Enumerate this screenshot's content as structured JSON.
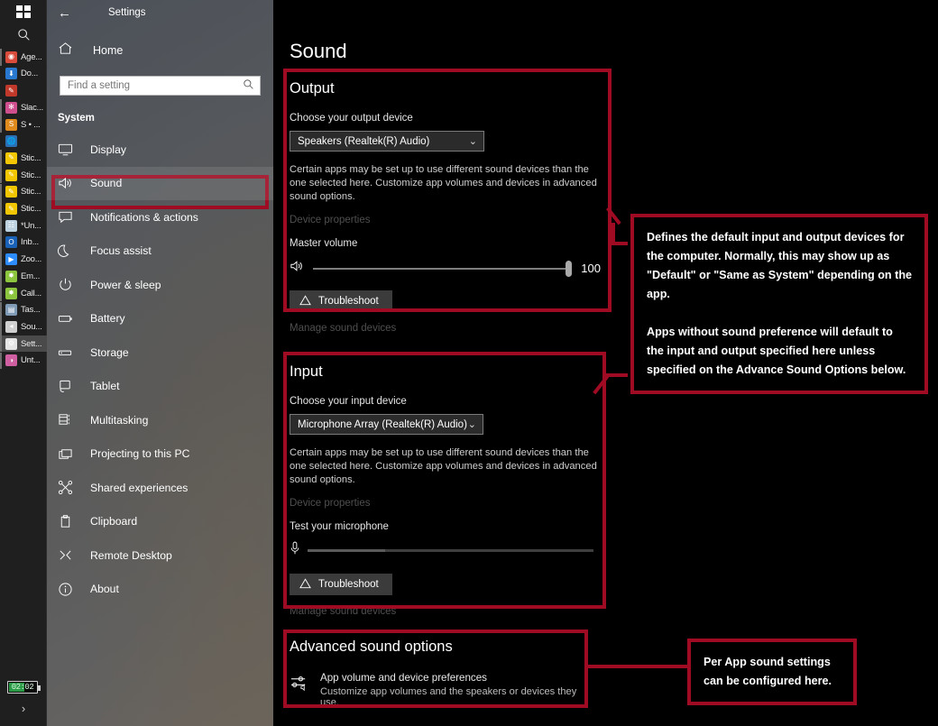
{
  "taskbar": {
    "start_icon": "windows-logo-icon",
    "search_icon": "search-icon",
    "battery": {
      "time": "02:02"
    },
    "overflow_chevron": "›",
    "items": [
      {
        "label": "Age...",
        "icon": "chrome-icon",
        "running": true,
        "active": false,
        "glyph": "◉",
        "color": "#d94b3a"
      },
      {
        "label": "Do...",
        "icon": "download-icon",
        "running": false,
        "active": false,
        "glyph": "⬇",
        "color": "#2878d0"
      },
      {
        "label": "",
        "icon": "paint-icon",
        "running": false,
        "active": false,
        "glyph": "✎",
        "color": "#c0392b"
      },
      {
        "label": "Slac...",
        "icon": "slack-icon",
        "running": true,
        "active": false,
        "glyph": "✻",
        "color": "#cf4f8e"
      },
      {
        "label": "S • ...",
        "icon": "sublime-icon",
        "running": true,
        "active": false,
        "glyph": "S",
        "color": "#e08a1e"
      },
      {
        "label": "",
        "icon": "globe-icon",
        "running": false,
        "active": false,
        "glyph": "🌐",
        "color": "#2b6fb5"
      },
      {
        "label": "Stic...",
        "icon": "sticky-note-icon",
        "running": true,
        "active": false,
        "glyph": "✎",
        "color": "#f2c600"
      },
      {
        "label": "Stic...",
        "icon": "sticky-note-icon",
        "running": true,
        "active": false,
        "glyph": "✎",
        "color": "#f2c600"
      },
      {
        "label": "Stic...",
        "icon": "sticky-note-icon",
        "running": true,
        "active": false,
        "glyph": "✎",
        "color": "#f2c600"
      },
      {
        "label": "Stic...",
        "icon": "sticky-note-icon",
        "running": true,
        "active": false,
        "glyph": "✎",
        "color": "#f2c600"
      },
      {
        "label": "*Un...",
        "icon": "notepad-icon",
        "running": true,
        "active": false,
        "glyph": "☷",
        "color": "#bcd2e0"
      },
      {
        "label": "Inb...",
        "icon": "outlook-icon",
        "running": true,
        "active": false,
        "glyph": "O",
        "color": "#1a62b8"
      },
      {
        "label": "Zoo...",
        "icon": "zoom-icon",
        "running": true,
        "active": false,
        "glyph": "▶",
        "color": "#2d8cff"
      },
      {
        "label": "Em...",
        "icon": "puzzle-icon",
        "running": true,
        "active": false,
        "glyph": "✸",
        "color": "#8cc63f"
      },
      {
        "label": "Call...",
        "icon": "puzzle-icon",
        "running": true,
        "active": false,
        "glyph": "✸",
        "color": "#8cc63f"
      },
      {
        "label": "Tas...",
        "icon": "task-manager-icon",
        "running": true,
        "active": false,
        "glyph": "▤",
        "color": "#7f9bb5"
      },
      {
        "label": "Sou...",
        "icon": "speaker-icon",
        "running": true,
        "active": false,
        "glyph": "◂",
        "color": "#d0d0d0"
      },
      {
        "label": "Sett...",
        "icon": "gear-icon",
        "running": true,
        "active": true,
        "glyph": "⚙",
        "color": "#e6e6e6"
      },
      {
        "label": "Unt...",
        "icon": "paint-3d-icon",
        "running": true,
        "active": false,
        "glyph": "◑",
        "color": "#cf5fa0"
      }
    ]
  },
  "nav": {
    "back_icon": "back-arrow-icon",
    "title": "Settings",
    "home_label": "Home",
    "home_icon": "home-icon",
    "search_placeholder": "Find a setting",
    "search_value": "",
    "search_icon": "search-icon",
    "section_label": "System",
    "items": [
      {
        "label": "Display",
        "icon": "monitor-icon",
        "selected": false
      },
      {
        "label": "Sound",
        "icon": "speaker-wave-icon",
        "selected": true
      },
      {
        "label": "Notifications & actions",
        "icon": "chat-bubble-icon",
        "selected": false
      },
      {
        "label": "Focus assist",
        "icon": "moon-icon",
        "selected": false
      },
      {
        "label": "Power & sleep",
        "icon": "power-icon",
        "selected": false
      },
      {
        "label": "Battery",
        "icon": "battery-icon",
        "selected": false
      },
      {
        "label": "Storage",
        "icon": "drive-icon",
        "selected": false
      },
      {
        "label": "Tablet",
        "icon": "tablet-icon",
        "selected": false
      },
      {
        "label": "Multitasking",
        "icon": "multitasking-icon",
        "selected": false
      },
      {
        "label": "Projecting to this PC",
        "icon": "project-screen-icon",
        "selected": false
      },
      {
        "label": "Shared experiences",
        "icon": "share-nodes-icon",
        "selected": false
      },
      {
        "label": "Clipboard",
        "icon": "clipboard-icon",
        "selected": false
      },
      {
        "label": "Remote Desktop",
        "icon": "remote-desktop-icon",
        "selected": false
      },
      {
        "label": "About",
        "icon": "info-circle-icon",
        "selected": false
      }
    ]
  },
  "main": {
    "page_title": "Sound",
    "output": {
      "heading": "Output",
      "device_label": "Choose your output device",
      "device_value": "Speakers (Realtek(R) Audio)",
      "description": "Certain apps may be set up to use different sound devices than the one selected here. Customize app volumes and devices in advanced sound options.",
      "device_properties_link": "Device properties",
      "volume_label": "Master volume",
      "volume_value": "100",
      "volume_percent": 100,
      "speaker_icon": "speaker-wave-icon",
      "troubleshoot_label": "Troubleshoot",
      "troubleshoot_icon": "warning-triangle-icon",
      "manage_link": "Manage sound devices"
    },
    "input": {
      "heading": "Input",
      "device_label": "Choose your input device",
      "device_value": "Microphone Array (Realtek(R) Audio)",
      "description": "Certain apps may be set up to use different sound devices than the one selected here. Customize app volumes and devices in advanced sound options.",
      "device_properties_link": "Device properties",
      "test_label": "Test your microphone",
      "mic_icon": "microphone-icon",
      "mic_level_percent": 27,
      "troubleshoot_label": "Troubleshoot",
      "troubleshoot_icon": "warning-triangle-icon",
      "manage_link": "Manage sound devices"
    },
    "advanced": {
      "heading": "Advanced sound options",
      "item_icon": "sliders-volume-icon",
      "item_title": "App volume and device preferences",
      "item_subtitle": "Customize app volumes and the speakers or devices they use."
    }
  },
  "annotations": {
    "accent_color": "#9e0b22",
    "devices_note": {
      "paragraphs": [
        "Defines the default input and output devices for the computer. Normally, this may show up as \"Default\" or \"Same as System\" depending on the app.",
        "Apps without sound preference will default to the input and output specified here unless specified on the Advance Sound Options below."
      ]
    },
    "advanced_note": {
      "paragraphs": [
        "Per App sound settings can be configured here."
      ]
    }
  }
}
